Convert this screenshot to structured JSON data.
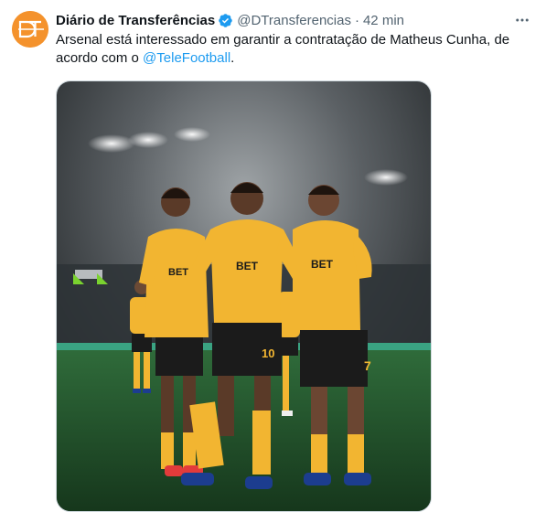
{
  "author": {
    "name": "Diário de Transferências",
    "handle": "@DTransferencias",
    "separator": "·",
    "time": "42 min",
    "avatar_icon": "dt-logo-icon",
    "avatar_letters": "DT",
    "avatar_color": "#f4922c"
  },
  "tweet": {
    "text_before": "Arsenal está interessado em garantir a contratação de Matheus Cunha, de acordo com o ",
    "mention": "@TeleFootball",
    "text_after": "."
  },
  "media": {
    "description_icon": "football-celebration-photo",
    "shirt_sponsor_left": "BET",
    "shirt_sponsor_center": "BET",
    "shirt_sponsor_right": "BET",
    "number_center": "10",
    "number_right": "7",
    "kit_color": "#f2b531",
    "shorts_color": "#1b1b1b"
  },
  "icons": {
    "verified": "verified-badge-icon",
    "more": "more-horizontal-icon"
  },
  "colors": {
    "text": "#0f1419",
    "secondary": "#536471",
    "link": "#1d9bf0",
    "verified": "#1d9bf0"
  }
}
